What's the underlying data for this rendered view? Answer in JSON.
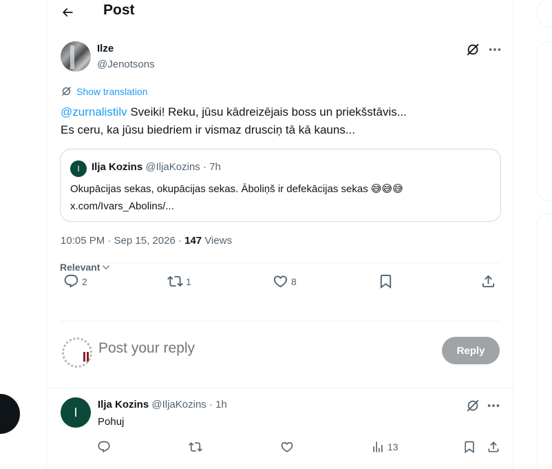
{
  "header": {
    "title": "Post"
  },
  "tweet": {
    "author_name": "Ilze",
    "author_handle": "@Jenotsons",
    "show_translation": "Show translation",
    "mention": "@zurnalistilv",
    "text_line1": " Sveiki! Reku, jūsu kādreizējais boss un priekšstāvis...",
    "text_line2": "Es ceru, ka jūsu biedriem ir vismaz drusciņ tā kā kauns...",
    "timestamp": "10:05 PM · Sep 15, 2026 · ",
    "views_count": "147",
    "views_label": " Views"
  },
  "quote": {
    "avatar_letter": "I",
    "name": "Ilja Kozins",
    "handle": "@IljaKozins",
    "time": " · 7h",
    "text_line1": "Okupācijas sekas, okupācijas sekas. Āboliņš ir defekācijas sekas 😅😅😅",
    "text_line2": "x.com/Ivars_Abolins/..."
  },
  "actions": {
    "replies": "2",
    "reposts": "1",
    "likes": "8"
  },
  "sort": {
    "label": "Relevant"
  },
  "composer": {
    "placeholder": "Post your reply",
    "button_label": "Reply"
  },
  "reply": {
    "avatar_letter": "I",
    "name": "Ilja Kozins",
    "handle": "@IljaKozins",
    "time": " · 1h",
    "text": "Pohuj",
    "views": "13"
  },
  "icons": {
    "back": "arrow-left-icon",
    "grok": "grok-icon",
    "more": "more-horizontal-icon",
    "reply": "comment-icon",
    "repost": "repost-icon",
    "like": "heart-icon",
    "bookmark": "bookmark-icon",
    "share": "share-icon",
    "views": "analytics-icon",
    "translate": "translate-icon",
    "chevron": "chevron-down-icon"
  },
  "colors": {
    "accent": "#1d9bf0",
    "text": "#0f1419",
    "muted": "#536471",
    "border": "#eff3f4",
    "reply_button": "#8f959a",
    "avatar_green": "#0b4a3a"
  }
}
